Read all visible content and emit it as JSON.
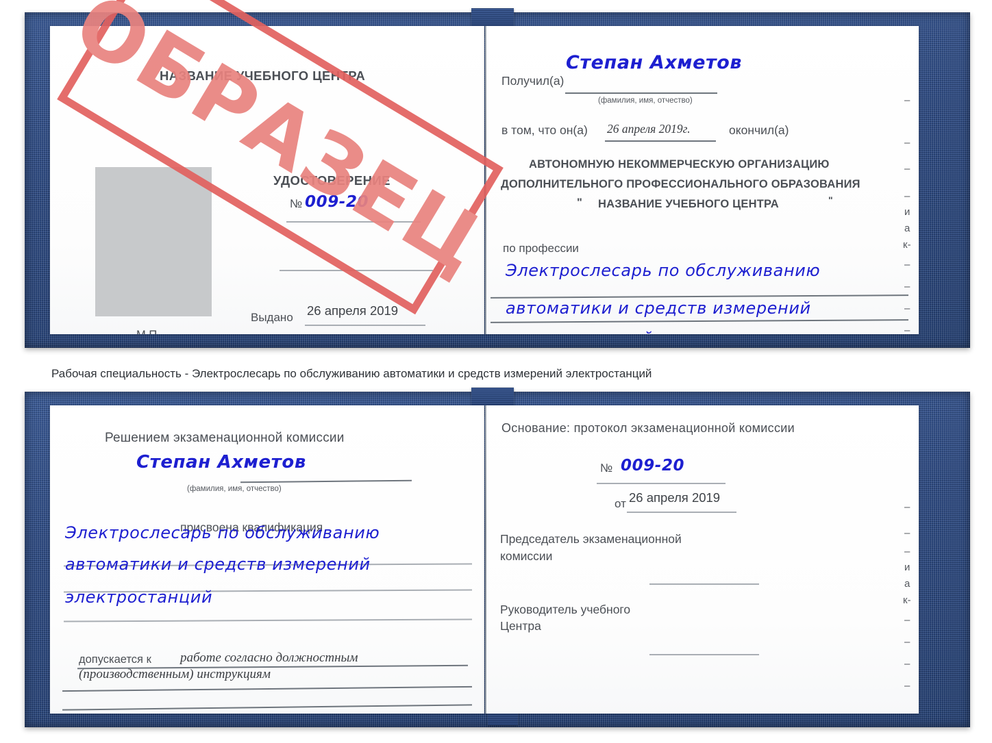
{
  "colors": {
    "cover_blue": "#27447c",
    "ink_blue": "#1d1fd0",
    "stamp_red": "#e2615f",
    "rule_gray": "#a9aeb4",
    "photo_gray": "#c7c9cb"
  },
  "watermark": {
    "text": "ОБРАЗЕЦ"
  },
  "certificate_top": {
    "left_page": {
      "center_name": "НАЗВАНИЕ УЧЕБНОГО ЦЕНТРА",
      "doc_type": "УДОСТОВЕРЕНИЕ",
      "number_label": "№",
      "number_value": "009-20",
      "issued_label": "Выдано",
      "issued_value": "26 апреля 2019",
      "seal_label": "М.П."
    },
    "right_page": {
      "received_label": "Получил(а)",
      "received_value": "Степан Ахметов",
      "fio_hint": "(фамилия, имя, отчество)",
      "that_label": "в том, что он(а)",
      "completion_date": "26 апреля 2019г.",
      "finished_label": "окончил(а)",
      "org_line1": "АВТОНОМНУЮ НЕКОММЕРЧЕСКУЮ ОРГАНИЗАЦИЮ",
      "org_line2": "ДОПОЛНИТЕЛЬНОГО ПРОФЕССИОНАЛЬНОГО ОБРАЗОВАНИЯ",
      "org_quote_open": "\"",
      "org_line3": "НАЗВАНИЕ УЧЕБНОГО ЦЕНТРА",
      "org_quote_close": "\"",
      "profession_label": "по профессии",
      "profession_line1": "Электрослесарь по обслуживанию",
      "profession_line2": "автоматики и средств измерений",
      "profession_line3": "электростанций",
      "edge_marks": [
        "–",
        "–",
        "–",
        "–",
        "и",
        "а",
        "к-",
        "–",
        "–",
        "–",
        "–"
      ]
    }
  },
  "caption": {
    "text": "Рабочая специальность - Электрослесарь по обслуживанию автоматики и средств измерений электростанций"
  },
  "certificate_bottom": {
    "left_page": {
      "decision_label": "Решением экзаменационной комиссии",
      "name_value": "Степан Ахметов",
      "fio_hint": "(фамилия, имя, отчество)",
      "qualification_label": "присвоена квалификация",
      "qualification_line1": "Электрослесарь по обслуживанию",
      "qualification_line2": "автоматики и средств измерений",
      "qualification_line3": "электростанций",
      "admitted_label": "допускается к",
      "admitted_line1": "работе согласно должностным",
      "admitted_line2": "(производственным) инструкциям"
    },
    "right_page": {
      "basis_label": "Основание: протокол экзаменационной комиссии",
      "number_label": "№",
      "number_value": "009-20",
      "date_label": "от",
      "date_value": "26 апреля 2019",
      "chairman_line1": "Председатель экзаменационной",
      "chairman_line2": "комиссии",
      "director_line1": "Руководитель учебного",
      "director_line2": "Центра",
      "edge_marks": [
        "–",
        "–",
        "и",
        "а",
        "к-",
        "–",
        "–",
        "–",
        "–"
      ]
    }
  }
}
